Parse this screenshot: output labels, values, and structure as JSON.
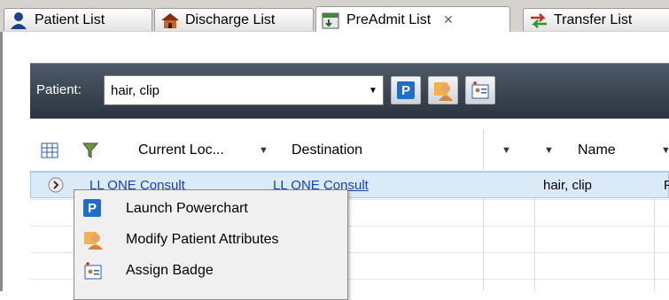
{
  "tabs": [
    {
      "label": "Patient List",
      "icon": "person-icon"
    },
    {
      "label": "Discharge List",
      "icon": "house-icon"
    },
    {
      "label": "PreAdmit List",
      "icon": "calendar-icon",
      "active": true,
      "close": "✕"
    },
    {
      "label": "Transfer List",
      "icon": "transfer-arrows-icon"
    }
  ],
  "toolbar": {
    "patient_label": "Patient:",
    "patient_value": "hair, clip",
    "buttons": [
      {
        "name": "launch-powerchart-button",
        "glyph": "P"
      },
      {
        "name": "modify-attributes-button",
        "icon": "person-edit-icon"
      },
      {
        "name": "assign-badge-button",
        "icon": "badge-icon"
      }
    ]
  },
  "grid": {
    "columns": [
      "Current Loc...",
      "Destination",
      "Name"
    ],
    "rows": [
      {
        "current_location": "LL ONE Consult",
        "destination": "LL ONE Consult",
        "name": "hair, clip",
        "extra": "F"
      }
    ]
  },
  "context_menu": {
    "items": [
      {
        "label": "Launch Powerchart",
        "icon": "powerchart-icon",
        "glyph": "P"
      },
      {
        "label": "Modify Patient Attributes",
        "icon": "person-edit-icon"
      },
      {
        "label": "Assign Badge",
        "icon": "badge-icon"
      }
    ]
  },
  "colors": {
    "toolbar_bg": "#2b3440",
    "selection": "#dbeaf7",
    "powerchart_blue": "#1f6fc8",
    "link": "#1a3fb0"
  }
}
